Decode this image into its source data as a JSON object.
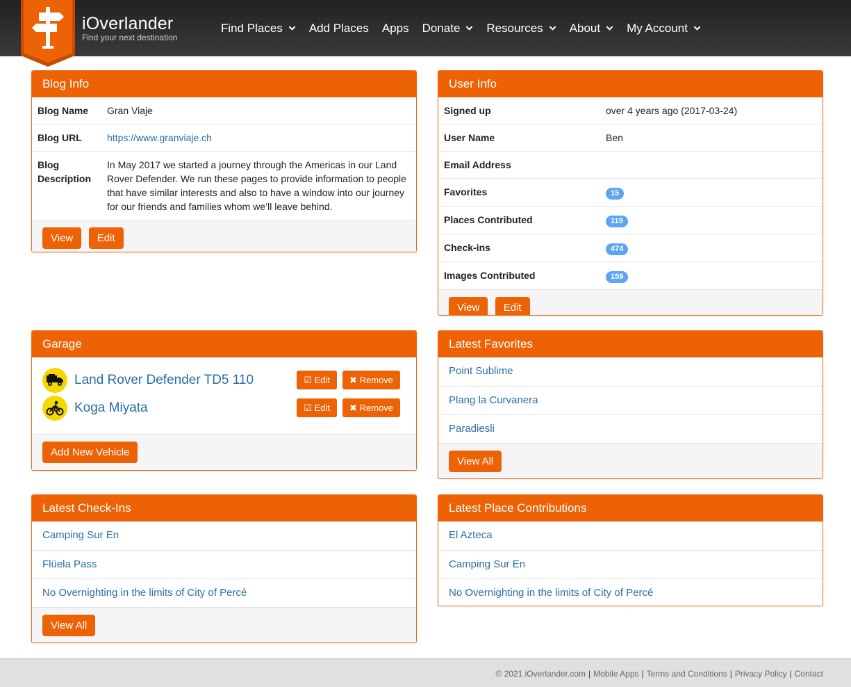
{
  "header": {
    "brand_name": "iOverlander",
    "brand_tagline": "Find your next destination",
    "nav": [
      {
        "label": "Find Places",
        "dropdown": true
      },
      {
        "label": "Add Places",
        "dropdown": false
      },
      {
        "label": "Apps",
        "dropdown": false
      },
      {
        "label": "Donate",
        "dropdown": true
      },
      {
        "label": "Resources",
        "dropdown": true
      },
      {
        "label": "About",
        "dropdown": true
      },
      {
        "label": "My Account",
        "dropdown": true
      }
    ]
  },
  "blog_info": {
    "title": "Blog Info",
    "rows": [
      {
        "key": "Blog Name",
        "value": "Gran Viaje"
      },
      {
        "key": "Blog URL",
        "value": "https://www.granviaje.ch"
      },
      {
        "key": "Blog Description",
        "value": "In May 2017 we started a journey through the Americas in our Land Rover Defender. We run these pages to provide information to people that have similar interests and also to have a window into our journey for our friends and families whom we’ll leave behind."
      }
    ],
    "view_label": "View",
    "edit_label": "Edit"
  },
  "user_info": {
    "title": "User Info",
    "signed_up_label": "Signed up",
    "signed_up_value": "over 4 years ago (2017-03-24)",
    "user_name_label": "User Name",
    "user_name_value": "Ben",
    "email_label": "Email Address",
    "email_value": "",
    "favorites_label": "Favorites",
    "favorites_count": "15",
    "places_label": "Places Contributed",
    "places_count": "119",
    "checkins_label": "Check-ins",
    "checkins_count": "474",
    "images_label": "Images Contributed",
    "images_count": "159",
    "view_label": "View",
    "edit_label": "Edit"
  },
  "garage": {
    "title": "Garage",
    "vehicles": [
      {
        "name": "Land Rover Defender TD5 110",
        "icon": "truck-icon"
      },
      {
        "name": "Koga Miyata",
        "icon": "cyclist-icon"
      }
    ],
    "edit_label": "Edit",
    "remove_label": "Remove",
    "add_label": "Add New Vehicle"
  },
  "latest_favorites": {
    "title": "Latest Favorites",
    "items": [
      "Point Sublime",
      "Plang la Curvanera",
      "Paradiesli"
    ],
    "view_all_label": "View All"
  },
  "latest_checkins": {
    "title": "Latest Check-Ins",
    "items": [
      "Camping Sur En",
      "Flüela Pass",
      "No Overnighting in the limits of City of Percé"
    ],
    "view_all_label": "View All"
  },
  "latest_contributions": {
    "title": "Latest Place Contributions",
    "items": [
      "El Azteca",
      "Camping Sur En",
      "No Overnighting in the limits of City of Percé"
    ]
  },
  "footer": {
    "copyright": "© 2021 iOverlander.com",
    "links": [
      "Mobile Apps",
      "Terms and Conditions",
      "Privacy Policy",
      "Contact"
    ]
  },
  "colors": {
    "accent": "#ee6206",
    "link": "#2a6da8",
    "badge": "#5ea4f0",
    "header": "#2e2e2e"
  }
}
